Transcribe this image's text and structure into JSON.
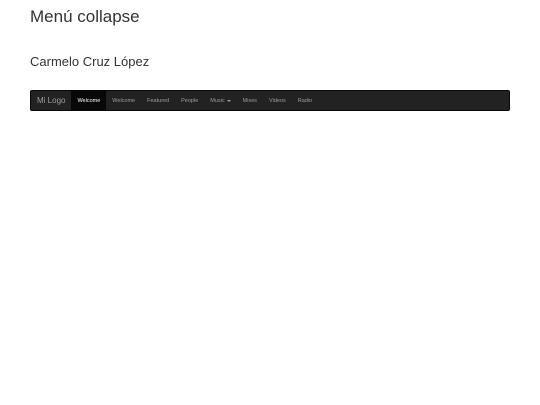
{
  "page": {
    "title": "Menú collapse",
    "author": "Carmelo Cruz López"
  },
  "navbar": {
    "brand": "Mi Logo",
    "items": [
      {
        "label": "Welcome",
        "active": true
      },
      {
        "label": "Welcome",
        "active": false
      },
      {
        "label": "Featured",
        "active": false
      },
      {
        "label": "People",
        "active": false
      },
      {
        "label": "Music",
        "active": false,
        "dropdown": true
      },
      {
        "label": "Mixes",
        "active": false
      },
      {
        "label": "Videos",
        "active": false
      },
      {
        "label": "Radio",
        "active": false
      }
    ],
    "colors": {
      "background": "#222222",
      "active_background": "#080808",
      "text": "#9d9d9d",
      "active_text": "#ffffff"
    }
  }
}
